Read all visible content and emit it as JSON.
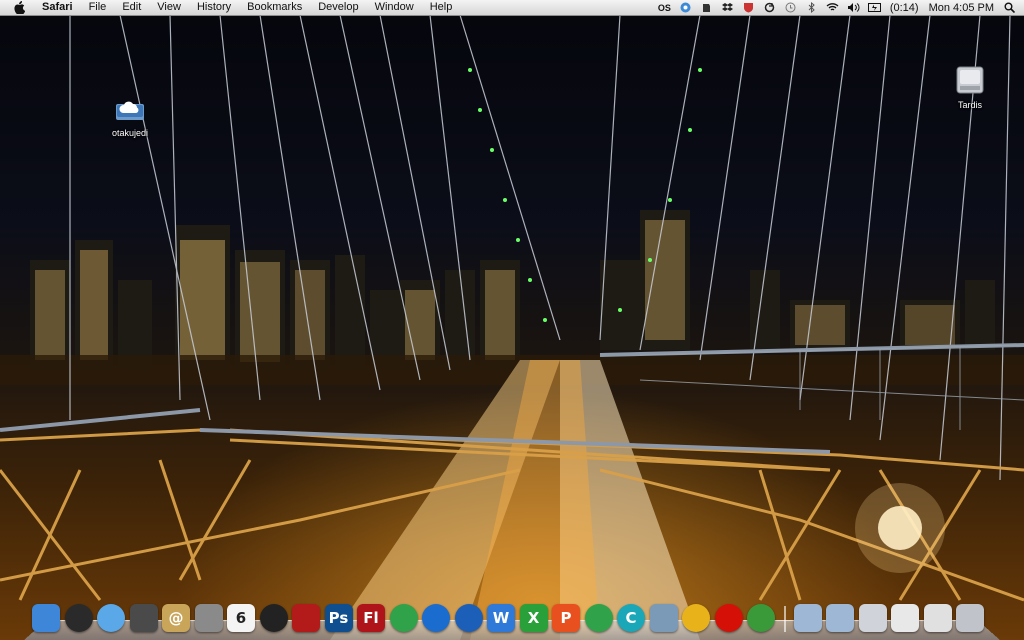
{
  "menubar": {
    "apple_icon": "apple-logo-icon",
    "app_name": "Safari",
    "menus": [
      "File",
      "Edit",
      "View",
      "History",
      "Bookmarks",
      "Develop",
      "Window",
      "Help"
    ],
    "status": {
      "os_label": "OS",
      "battery_time": "(0:14)",
      "clock": "Mon 4:05 PM"
    }
  },
  "desktop": {
    "icons": [
      {
        "label": "otakujedi",
        "icon": "icloud-drive-icon"
      },
      {
        "label": "Tardis",
        "icon": "hard-drive-icon"
      }
    ]
  },
  "dock": {
    "apps": [
      {
        "name": "finder",
        "glyph": "",
        "color": "#3d86d8"
      },
      {
        "name": "dashboard",
        "glyph": "",
        "color": "#2a2a2a"
      },
      {
        "name": "ichat",
        "glyph": "",
        "color": "#5aa8e8"
      },
      {
        "name": "imovie",
        "glyph": "",
        "color": "#4a4a4a"
      },
      {
        "name": "address-book",
        "glyph": "@",
        "color": "#c9a55a"
      },
      {
        "name": "system-preferences",
        "glyph": "",
        "color": "#8a8a8a"
      },
      {
        "name": "ical",
        "glyph": "6",
        "color": "#f4f4f4"
      },
      {
        "name": "aperture",
        "glyph": "",
        "color": "#222222"
      },
      {
        "name": "photo-booth",
        "glyph": "",
        "color": "#b31b1b"
      },
      {
        "name": "photoshop",
        "glyph": "Ps",
        "color": "#0f4f8f"
      },
      {
        "name": "flash",
        "glyph": "Fl",
        "color": "#b0141b"
      },
      {
        "name": "messenger",
        "glyph": "",
        "color": "#2fa24a"
      },
      {
        "name": "safari",
        "glyph": "",
        "color": "#1a6ccf"
      },
      {
        "name": "itunes",
        "glyph": "",
        "color": "#1c5fb8"
      },
      {
        "name": "word",
        "glyph": "W",
        "color": "#2f7ad8"
      },
      {
        "name": "excel",
        "glyph": "X",
        "color": "#2aa03b"
      },
      {
        "name": "powerpoint",
        "glyph": "P",
        "color": "#e8511f"
      },
      {
        "name": "messenger-2",
        "glyph": "",
        "color": "#2fa24a"
      },
      {
        "name": "cyberduck",
        "glyph": "C",
        "color": "#1aa7b8"
      },
      {
        "name": "preview",
        "glyph": "",
        "color": "#7a9ab8"
      },
      {
        "name": "adium",
        "glyph": "",
        "color": "#e8b31a"
      },
      {
        "name": "lastfm",
        "glyph": "",
        "color": "#d51007"
      },
      {
        "name": "chrome",
        "glyph": "",
        "color": "#3a9a3a"
      }
    ],
    "stacks": [
      {
        "name": "applications-folder"
      },
      {
        "name": "documents-folder"
      },
      {
        "name": "downloads-stack"
      },
      {
        "name": "screenshot-stack"
      },
      {
        "name": "recent-stack"
      },
      {
        "name": "trash"
      }
    ]
  }
}
